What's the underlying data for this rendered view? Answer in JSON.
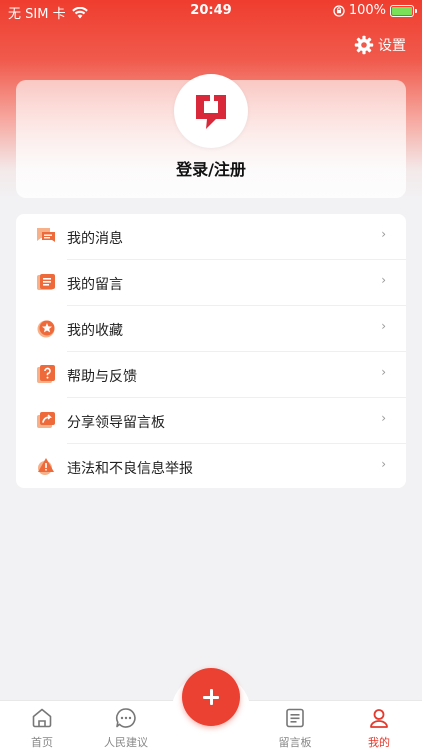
{
  "status_bar": {
    "carrier": "无 SIM 卡",
    "time": "20:49",
    "battery": "100%"
  },
  "header": {
    "settings_label": "设置"
  },
  "profile": {
    "login_label": "登录/注册"
  },
  "menu": {
    "items": [
      {
        "label": "我的消息",
        "icon": "message-icon"
      },
      {
        "label": "我的留言",
        "icon": "comment-list-icon"
      },
      {
        "label": "我的收藏",
        "icon": "star-icon"
      },
      {
        "label": "帮助与反馈",
        "icon": "help-icon"
      },
      {
        "label": "分享领导留言板",
        "icon": "share-icon"
      },
      {
        "label": "违法和不良信息举报",
        "icon": "report-icon"
      }
    ],
    "arrow": "›"
  },
  "tabbar": {
    "tabs": [
      {
        "label": "首页",
        "active": false
      },
      {
        "label": "人民建议",
        "active": false
      },
      {
        "label": "留言板",
        "active": false
      },
      {
        "label": "我的",
        "active": true
      }
    ]
  },
  "colors": {
    "accent": "#ea4132",
    "active_tab": "#e43a2e",
    "icon_orange": "#f07a3c"
  }
}
